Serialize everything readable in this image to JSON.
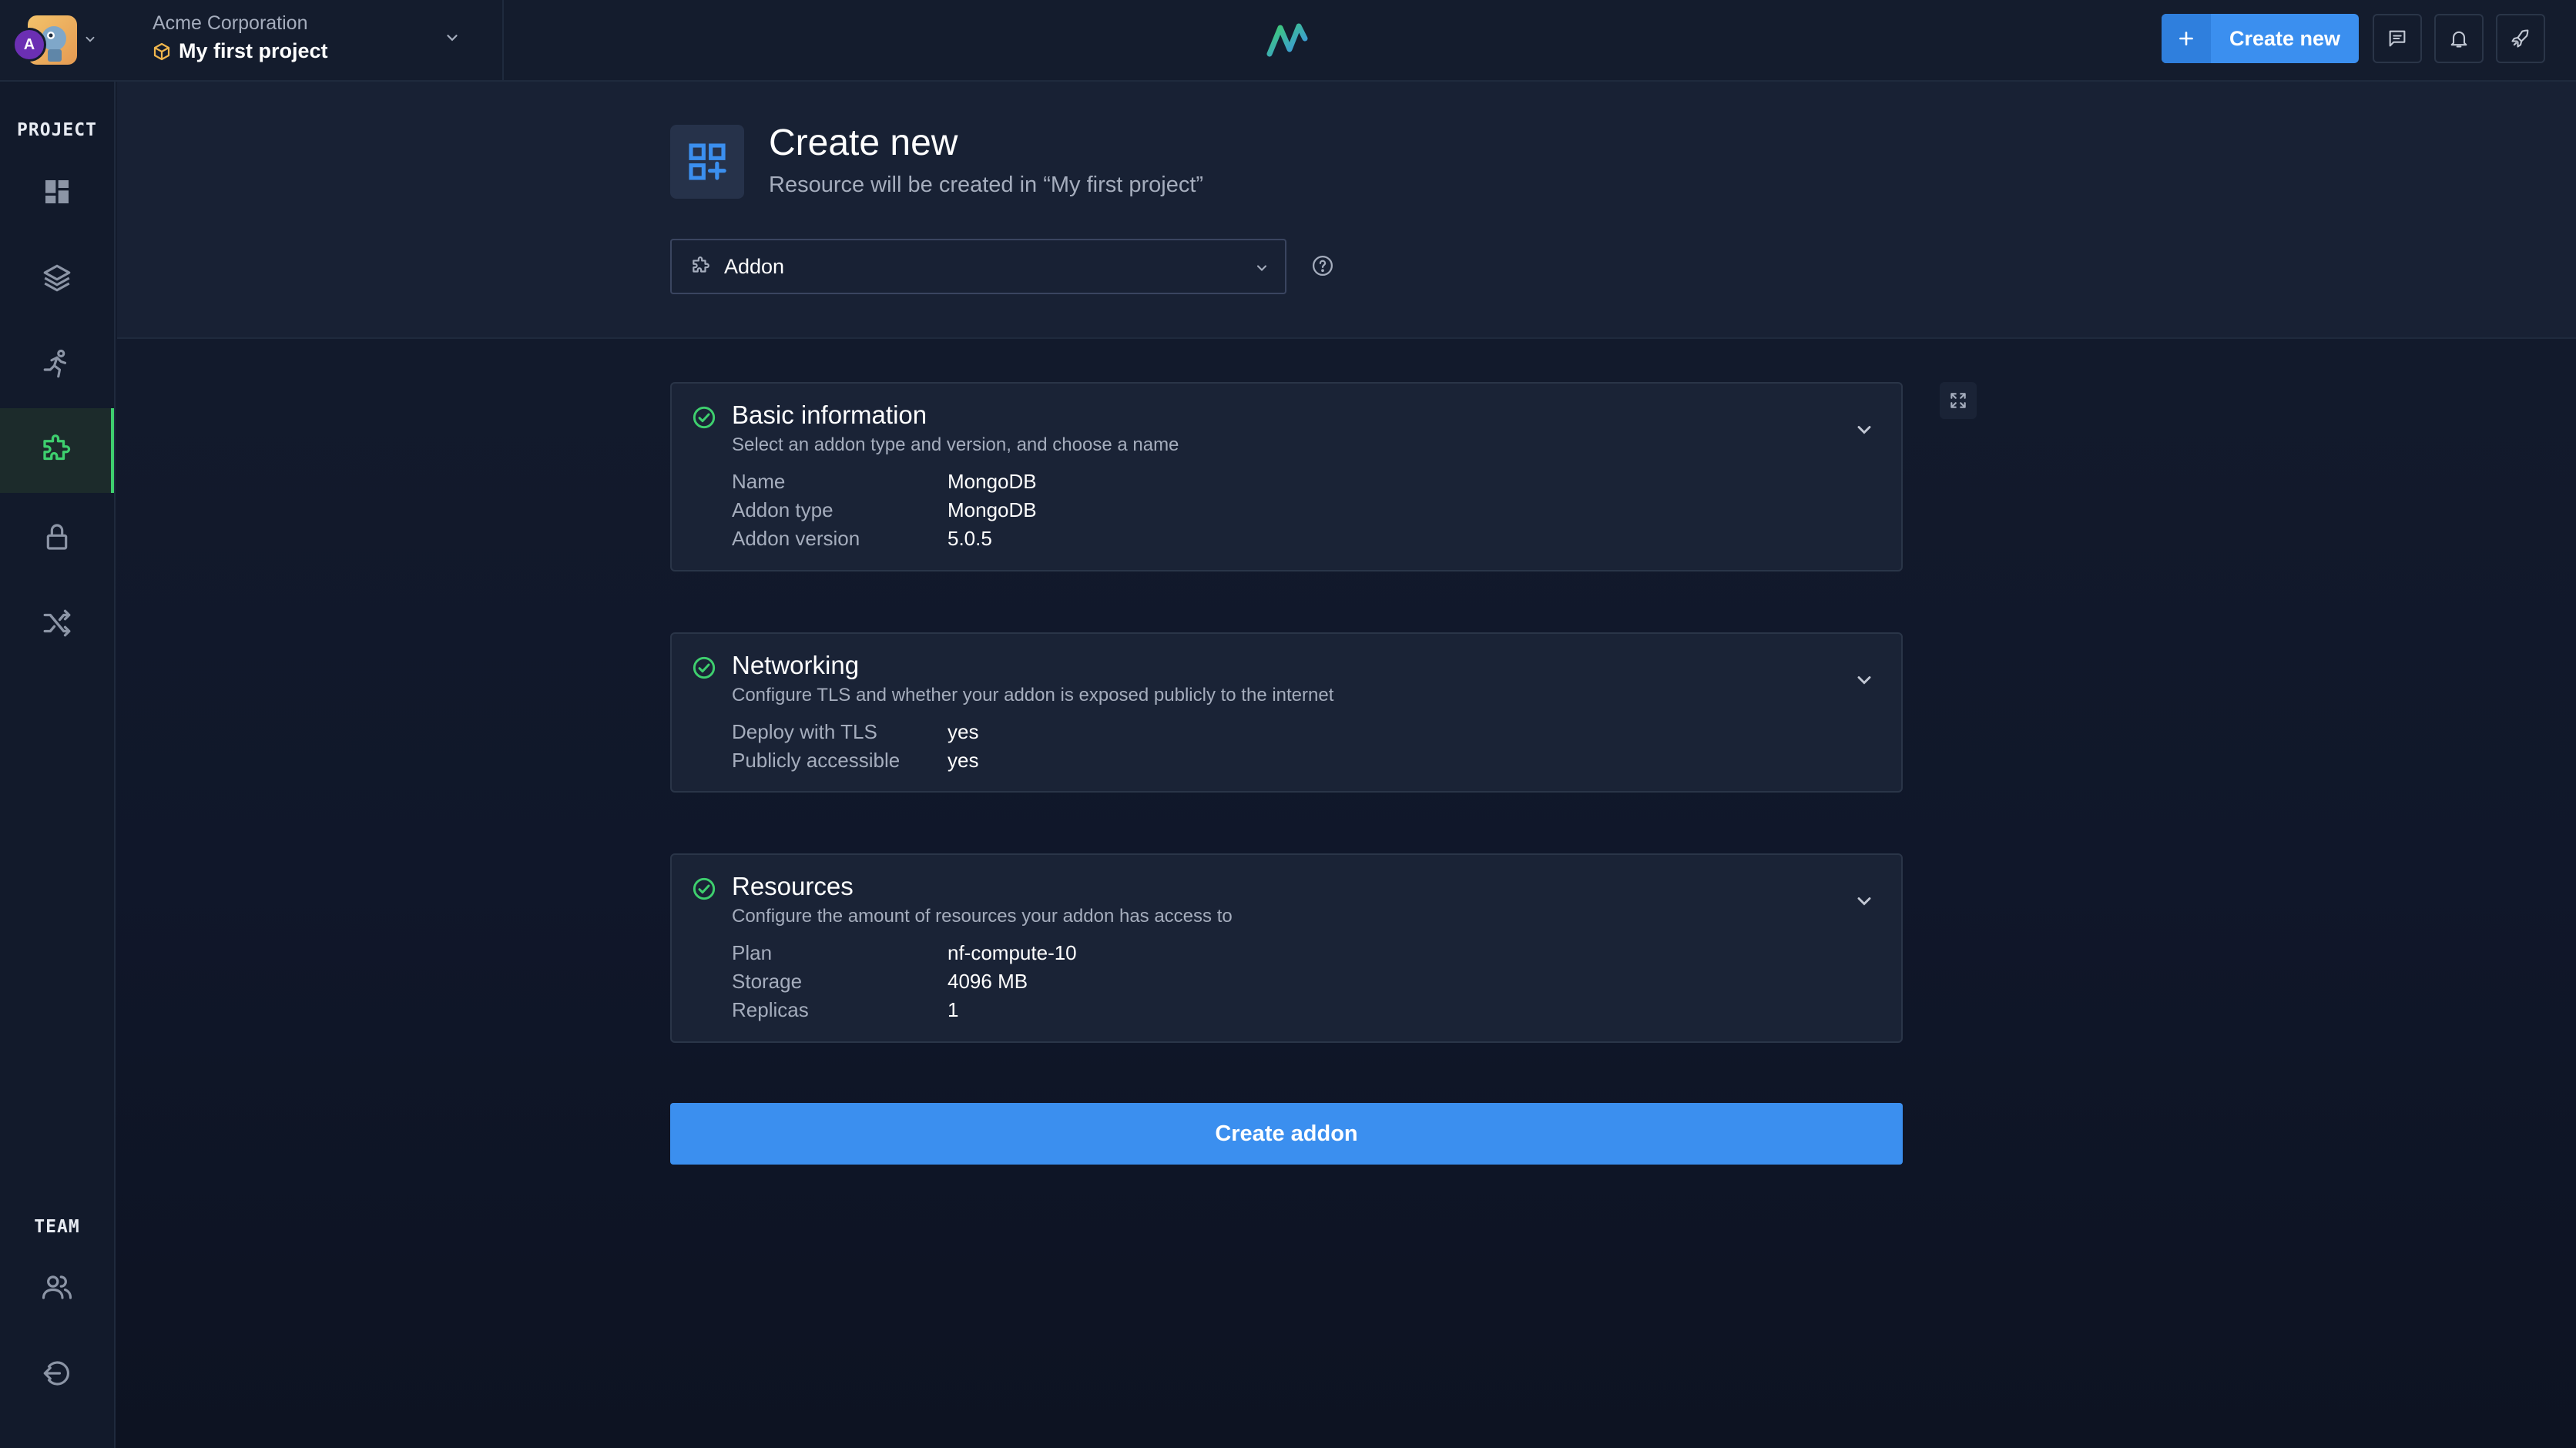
{
  "topbar": {
    "user_initial": "A",
    "org_name": "Acme Corporation",
    "project_name": "My first project",
    "create_new_label": "Create new",
    "icons": [
      "plus-icon",
      "comment-icon",
      "bell-icon",
      "rocket-icon"
    ]
  },
  "sidebar": {
    "project_label": "PROJECT",
    "team_label": "TEAM",
    "items": [
      {
        "name": "dashboard",
        "icon": "grid-icon"
      },
      {
        "name": "services",
        "icon": "layers-icon"
      },
      {
        "name": "jobs",
        "icon": "runner-icon"
      },
      {
        "name": "addons",
        "icon": "puzzle-icon",
        "active": true
      },
      {
        "name": "secrets",
        "icon": "lock-icon"
      },
      {
        "name": "pipelines",
        "icon": "shuffle-icon"
      },
      {
        "name": "team",
        "icon": "users-icon"
      },
      {
        "name": "logout",
        "icon": "logout-icon"
      }
    ]
  },
  "header": {
    "title": "Create new",
    "subtitle": "Resource will be created in “My first project”",
    "resource_type": "Addon"
  },
  "sections": {
    "basic": {
      "title": "Basic information",
      "description": "Select an addon type and version, and choose a name",
      "rows": [
        {
          "key": "Name",
          "value": "MongoDB"
        },
        {
          "key": "Addon type",
          "value": "MongoDB"
        },
        {
          "key": "Addon version",
          "value": "5.0.5"
        }
      ]
    },
    "networking": {
      "title": "Networking",
      "description": "Configure TLS and whether your addon is exposed publicly to the internet",
      "rows": [
        {
          "key": "Deploy with TLS",
          "value": "yes"
        },
        {
          "key": "Publicly accessible",
          "value": "yes"
        }
      ]
    },
    "resources": {
      "title": "Resources",
      "description": "Configure the amount of resources your addon has access to",
      "rows": [
        {
          "key": "Plan",
          "value": "nf-compute-10"
        },
        {
          "key": "Storage",
          "value": "4096 MB"
        },
        {
          "key": "Replicas",
          "value": "1"
        }
      ]
    }
  },
  "actions": {
    "create_addon_label": "Create addon"
  },
  "colors": {
    "accent": "#3b8fef",
    "success": "#3ecf6e",
    "background": "#141c2d"
  }
}
